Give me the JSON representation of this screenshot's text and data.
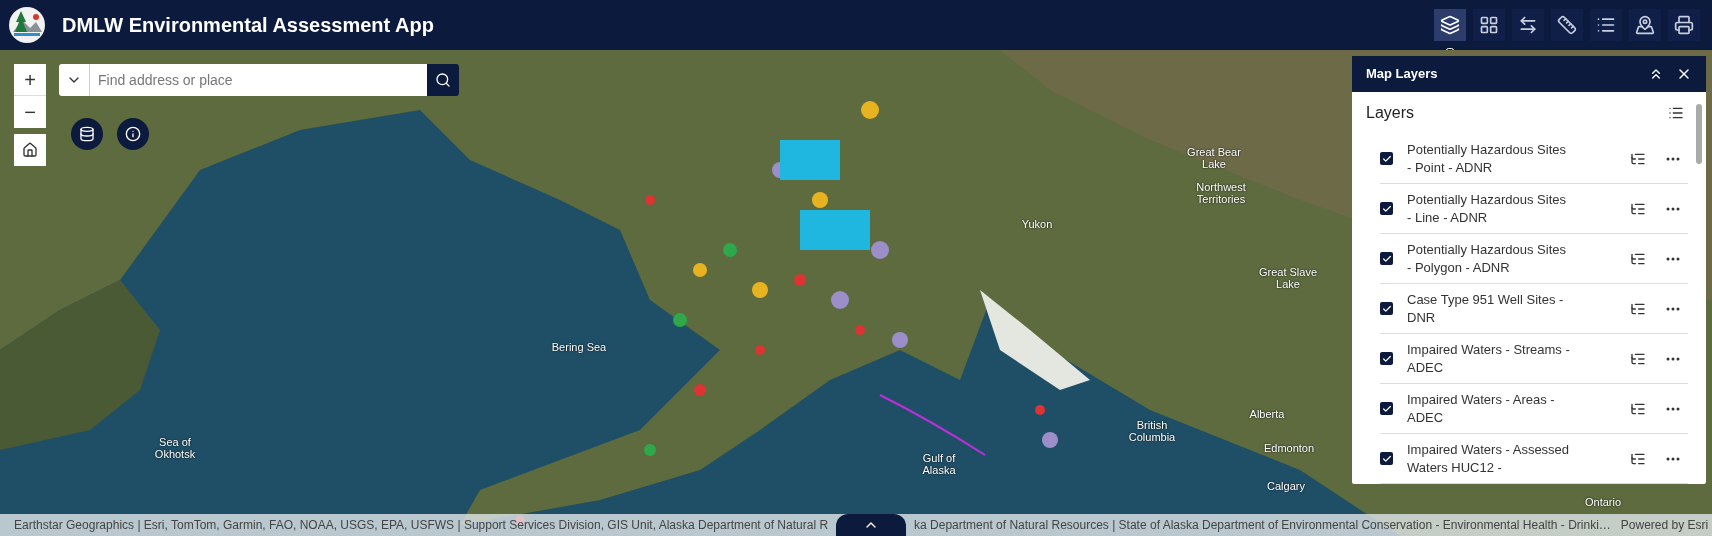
{
  "header": {
    "title": "DMLW Environmental Assessment App"
  },
  "toolbar": [
    {
      "kind": "layers",
      "selected": true
    },
    {
      "kind": "grid",
      "selected": false
    },
    {
      "kind": "xyz",
      "selected": false
    },
    {
      "kind": "ruler",
      "selected": false
    },
    {
      "kind": "list",
      "selected": false
    },
    {
      "kind": "pins",
      "selected": false
    },
    {
      "kind": "print",
      "selected": false
    }
  ],
  "search": {
    "placeholder": "Find address or place"
  },
  "zoom": {
    "in": "+",
    "out": "−"
  },
  "map_labels": [
    {
      "text": "Bering Sea"
    },
    {
      "text": "Gulf of\nAlaska"
    },
    {
      "text": "Sea of\nOkhotsk"
    },
    {
      "text": "Yukon"
    },
    {
      "text": "Great Bear\nLake"
    },
    {
      "text": "Northwest\nTerritories"
    },
    {
      "text": "Great Slave\nLake"
    },
    {
      "text": "British\nColumbia"
    },
    {
      "text": "Alberta"
    },
    {
      "text": "Edmonton"
    },
    {
      "text": "Calgary"
    },
    {
      "text": "Ontario"
    }
  ],
  "panel": {
    "title": "Map Layers",
    "heading": "Layers",
    "layers": [
      {
        "label": "Potentially Hazardous Sites - Point - ADNR",
        "checked": true
      },
      {
        "label": "Potentially Hazardous Sites - Line - ADNR",
        "checked": true
      },
      {
        "label": "Potentially Hazardous Sites - Polygon - ADNR",
        "checked": true
      },
      {
        "label": "Case Type 951 Well Sites - DNR",
        "checked": true
      },
      {
        "label": "Impaired Waters - Streams - ADEC",
        "checked": true
      },
      {
        "label": "Impaired Waters - Areas - ADEC",
        "checked": true
      },
      {
        "label": "Impaired Waters - Assessed Waters HUC12 -",
        "checked": true
      }
    ]
  },
  "attribution": {
    "left": "Earthstar Geographics | Esri, TomTom, Garmin, FAO, NOAA, USGS, EPA, USFWS | Support Services Division, GIS Unit, Alaska Department of Natural R",
    "right": "ka Department of Natural Resources | State of Alaska Department of Environmental Conservation - Environmental Health - Drinki…",
    "powered": "Powered by Esri"
  }
}
